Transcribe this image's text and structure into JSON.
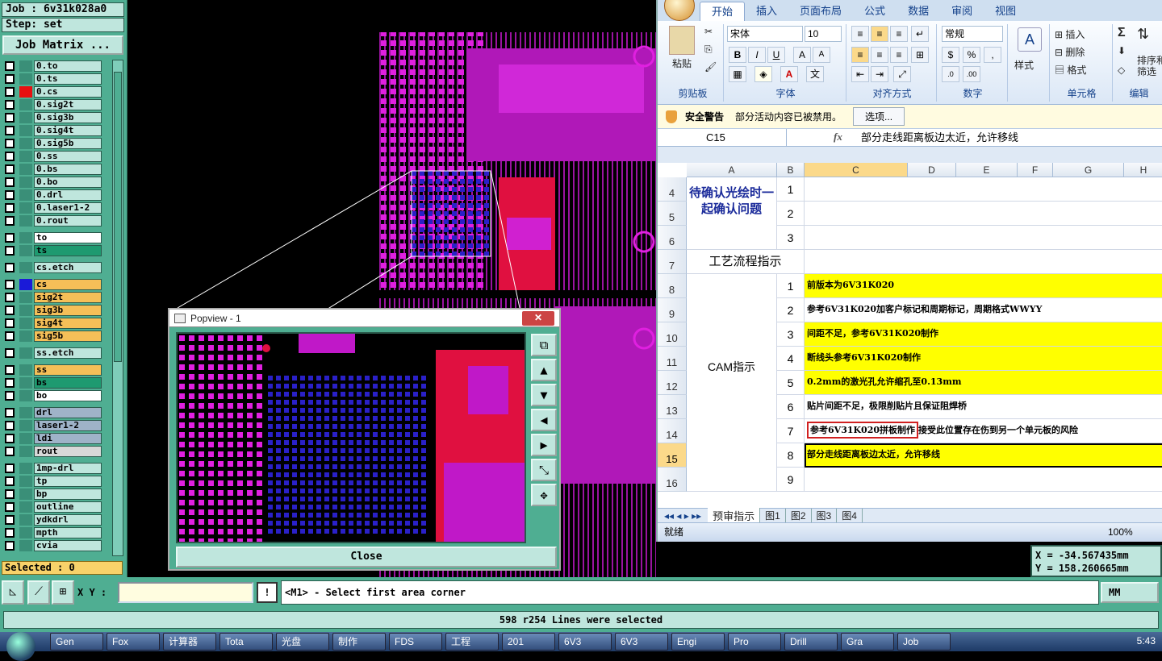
{
  "cam": {
    "job_label": "Job : 6v31k028a0",
    "step_label": "Step: set",
    "job_matrix_button": "Job Matrix ...",
    "selected_label": "Selected : 0",
    "layers": [
      {
        "name": "0.to",
        "color": "#3a8f78",
        "bg": "#bfe6dd"
      },
      {
        "name": "0.ts",
        "color": "#3a8f78",
        "bg": "#bfe6dd"
      },
      {
        "name": "0.cs",
        "color": "#e81010",
        "bg": "#bfe6dd"
      },
      {
        "name": "0.sig2t",
        "color": "#3a8f78",
        "bg": "#bfe6dd"
      },
      {
        "name": "0.sig3b",
        "color": "#3a8f78",
        "bg": "#bfe6dd"
      },
      {
        "name": "0.sig4t",
        "color": "#3a8f78",
        "bg": "#bfe6dd"
      },
      {
        "name": "0.sig5b",
        "color": "#3a8f78",
        "bg": "#bfe6dd"
      },
      {
        "name": "0.ss",
        "color": "#3a8f78",
        "bg": "#bfe6dd"
      },
      {
        "name": "0.bs",
        "color": "#3a8f78",
        "bg": "#bfe6dd"
      },
      {
        "name": "0.bo",
        "color": "#3a8f78",
        "bg": "#bfe6dd"
      },
      {
        "name": "0.drl",
        "color": "#3a8f78",
        "bg": "#bfe6dd"
      },
      {
        "name": "0.laser1-2",
        "color": "#3a8f78",
        "bg": "#bfe6dd"
      },
      {
        "name": "0.rout",
        "color": "#3a8f78",
        "bg": "#bfe6dd",
        "sepAfter": true
      },
      {
        "name": "to",
        "color": "#3a8f78",
        "bg": "#ffffff"
      },
      {
        "name": "ts",
        "color": "#3a8f78",
        "bg": "#1e9a70",
        "sepAfter": true
      },
      {
        "name": "cs.etch",
        "color": "#3a8f78",
        "bg": "#bfe6dd",
        "sepAfter": true
      },
      {
        "name": "cs",
        "color": "#1a1ad8",
        "bg": "#f5bf58",
        "checked": true
      },
      {
        "name": "sig2t",
        "color": "#3a8f78",
        "bg": "#f5bf58"
      },
      {
        "name": "sig3b",
        "color": "#3a8f78",
        "bg": "#f5bf58"
      },
      {
        "name": "sig4t",
        "color": "#3a8f78",
        "bg": "#f5bf58"
      },
      {
        "name": "sig5b",
        "color": "#3a8f78",
        "bg": "#f5bf58",
        "sepAfter": true
      },
      {
        "name": "ss.etch",
        "color": "#3a8f78",
        "bg": "#bfe6dd",
        "sepAfter": true
      },
      {
        "name": "ss",
        "color": "#3a8f78",
        "bg": "#f5bf58"
      },
      {
        "name": "bs",
        "color": "#3a8f78",
        "bg": "#1e9a70"
      },
      {
        "name": "bo",
        "color": "#3a8f78",
        "bg": "#ffffff",
        "sepAfter": true
      },
      {
        "name": "drl",
        "color": "#3a8f78",
        "bg": "#9fb3c8"
      },
      {
        "name": "laser1-2",
        "color": "#3a8f78",
        "bg": "#9fb3c8"
      },
      {
        "name": "ldi",
        "color": "#3a8f78",
        "bg": "#9fb3c8"
      },
      {
        "name": "rout",
        "color": "#3a8f78",
        "bg": "#d8d8d8",
        "sepAfter": true
      },
      {
        "name": "1mp-drl",
        "color": "#3a8f78",
        "bg": "#bfe6dd"
      },
      {
        "name": "tp",
        "color": "#3a8f78",
        "bg": "#bfe6dd"
      },
      {
        "name": "bp",
        "color": "#3a8f78",
        "bg": "#bfe6dd"
      },
      {
        "name": "outline",
        "color": "#3a8f78",
        "bg": "#bfe6dd"
      },
      {
        "name": "ydkdrl",
        "color": "#3a8f78",
        "bg": "#bfe6dd"
      },
      {
        "name": "mpth",
        "color": "#3a8f78",
        "bg": "#bfe6dd"
      },
      {
        "name": "cvia",
        "color": "#3a8f78",
        "bg": "#bfe6dd"
      }
    ],
    "popview": {
      "title": "Popview - 1",
      "close_label": "Close"
    },
    "coords": {
      "x": "X = -34.567435mm",
      "y": "Y = 158.260665mm"
    },
    "xy_label": "X Y :",
    "prompt": "<M1> - Select first area corner",
    "units": "MM",
    "message": "598 r254 Lines were selected"
  },
  "excel": {
    "tabs": [
      "开始",
      "插入",
      "页面布局",
      "公式",
      "数据",
      "审阅",
      "视图"
    ],
    "font_name": "宋体",
    "font_size": "10",
    "number_format": "常规",
    "groups": [
      "剪贴板",
      "字体",
      "对齐方式",
      "数字",
      "单元格",
      "编辑"
    ],
    "paste": "粘贴",
    "style": "样式",
    "insert": "插入",
    "delete": "删除",
    "format": "格式",
    "sort": "排序和\n筛选",
    "security_title": "安全警告",
    "security_msg": "部分活动内容已被禁用。",
    "options_btn": "选项...",
    "name_box": "C15",
    "formula": "部分走线距离板边太近，允许移线",
    "columns": [
      "A",
      "B",
      "C",
      "D",
      "E",
      "F",
      "G",
      "H"
    ],
    "rows": [
      {
        "r": "4"
      },
      {
        "r": "5"
      },
      {
        "r": "6"
      },
      {
        "r": "7"
      },
      {
        "r": "8"
      },
      {
        "r": "9"
      },
      {
        "r": "10"
      },
      {
        "r": "11"
      },
      {
        "r": "12"
      },
      {
        "r": "13"
      },
      {
        "r": "14"
      },
      {
        "r": "15"
      },
      {
        "r": "16"
      }
    ],
    "a_block1": "待确认光绘时一起确认问题",
    "a_block1_nums": [
      "1",
      "2",
      "3"
    ],
    "row7": "工艺流程指示",
    "cam_label": "CAM指示",
    "cam_items": [
      {
        "n": "1",
        "text": "前版本为6V31K020",
        "yellow": true
      },
      {
        "n": "2",
        "text": "参考6V31K020加客户标记和周期标记，周期格式WWYY",
        "yellow": false
      },
      {
        "n": "3",
        "text": "间距不足，参考6V31K020制作",
        "yellow": true
      },
      {
        "n": "4",
        "text": "断线头参考6V31K020制作",
        "yellow": true
      },
      {
        "n": "5",
        "text": "0.2mm的激光孔允许缩孔至0.13mm",
        "yellow": true
      },
      {
        "n": "6",
        "text": "贴片间距不足，极限削贴片且保证阻焊桥",
        "yellow": false
      },
      {
        "n": "7",
        "text": "参考6V31K020拼板制作",
        "text2": "接受此位置存在伤到另一个单元板的风险",
        "yellow": false
      },
      {
        "n": "8",
        "text": "部分走线距离板边太近，允许移线",
        "yellow": true
      },
      {
        "n": "9",
        "text": "",
        "yellow": false
      }
    ],
    "sheet_tabs": [
      "预审指示",
      "图1",
      "图2",
      "图3",
      "图4"
    ],
    "status": "就绪",
    "zoom": "100%"
  },
  "taskbar": [
    "Gen",
    "Fox",
    "计算器",
    "Tota",
    "光盘",
    "制作",
    "FDS",
    "工程",
    "201",
    "6V3",
    "6V3",
    "Engi",
    "Pro",
    "Drill",
    "Gra",
    "Job"
  ],
  "clock": "5:43"
}
